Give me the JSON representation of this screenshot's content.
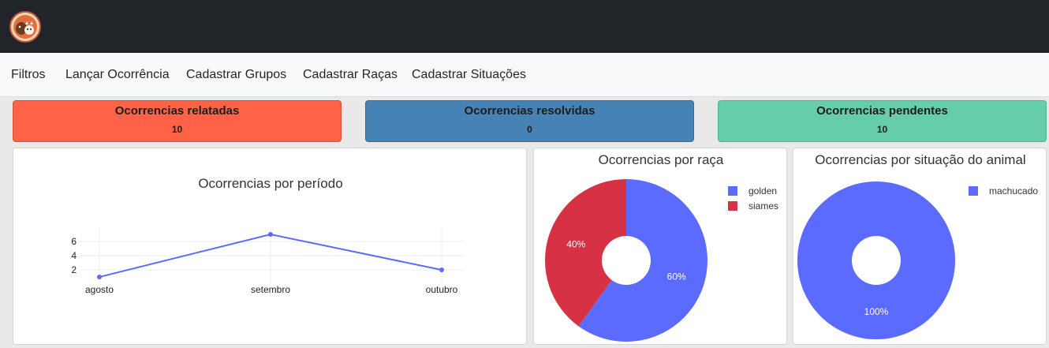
{
  "nav": {
    "items": [
      "Filtros",
      "Lançar Ocorrência",
      "Cadastrar Grupos",
      "Cadastrar Raças",
      "Cadastrar Situações"
    ]
  },
  "stats": [
    {
      "title": "Ocorrencias relatadas",
      "value": "10",
      "color": "#ff6347"
    },
    {
      "title": "Ocorrencias resolvidas",
      "value": "0",
      "color": "#4682b4"
    },
    {
      "title": "Ocorrencias pendentes",
      "value": "10",
      "color": "#66cdaa"
    }
  ],
  "colors": {
    "series_blue": "#5b6bff",
    "series_red": "#d63144",
    "topbar": "#212529"
  },
  "chart_data": [
    {
      "type": "line",
      "title": "Ocorrencias por período",
      "categories": [
        "agosto",
        "setembro",
        "outubro"
      ],
      "values": [
        1,
        7,
        2
      ],
      "yticks": [
        2,
        4,
        6
      ],
      "ylim": [
        0,
        8
      ],
      "grid": true
    },
    {
      "type": "pie",
      "title": "Ocorrencias por raça",
      "labels": [
        "golden",
        "siames"
      ],
      "values": [
        60,
        40
      ],
      "percent_labels": [
        "60%",
        "40%"
      ],
      "colors": [
        "#5b6bff",
        "#d63144"
      ],
      "legend": "top-right"
    },
    {
      "type": "pie",
      "title": "Ocorrencias por situação do animal",
      "labels": [
        "machucado"
      ],
      "values": [
        100
      ],
      "percent_labels": [
        "100%"
      ],
      "colors": [
        "#5b6bff"
      ],
      "legend": "top-right"
    }
  ]
}
